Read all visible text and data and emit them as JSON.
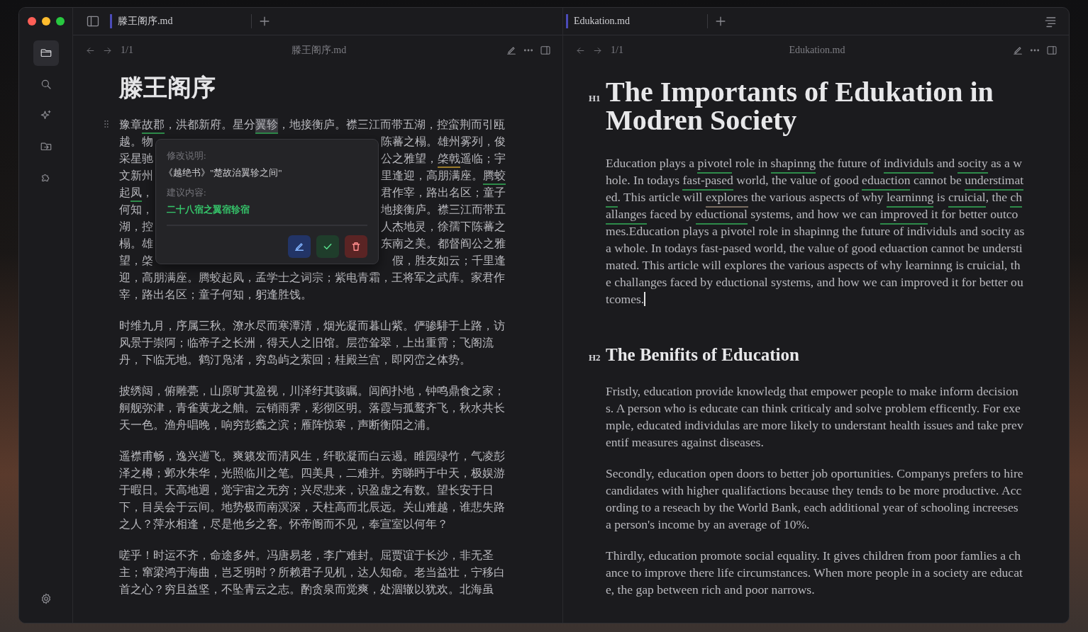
{
  "window": {
    "traffic_lights": [
      {
        "color": "#ff5f57"
      },
      {
        "color": "#febc2e"
      },
      {
        "color": "#28c840"
      }
    ]
  },
  "rail": {
    "items": [
      {
        "kind": "folder",
        "selected": true
      },
      {
        "kind": "search",
        "selected": false
      },
      {
        "kind": "sparkle",
        "selected": false
      },
      {
        "kind": "folder-arrow",
        "selected": false
      },
      {
        "kind": "puzzle",
        "selected": false
      }
    ],
    "bottom": [
      {
        "kind": "gear"
      }
    ]
  },
  "panes": [
    {
      "tab": {
        "title": "滕王阁序.md",
        "selected": true
      },
      "toolbar": {
        "page": "1/1",
        "title": "滕王阁序.md"
      },
      "blocks": [
        {
          "kind": "title",
          "text": "滕王阁序"
        },
        {
          "kind": "covered",
          "popup": {
            "note_label": "修改说明:",
            "note": "《越绝书》\"楚故治翼轸之间\"",
            "suggestion_label": "建议内容:",
            "suggestion": "二十八宿之翼宿轸宿",
            "actions": [
              {
                "kind": "edit"
              },
              {
                "kind": "accept"
              },
              {
                "kind": "delete"
              }
            ]
          },
          "lines": [
            {
              "full": [
                "豫章",
                {
                  "text": "故郡",
                  "color": "#2e8b4a",
                  "selected": false
                },
                "，洪都新府。星分",
                {
                  "text": "翼轸",
                  "color": "#2e8b4a",
                  "selected": true
                },
                "，地接衡庐。襟三江而带五湖，控蛮荆而引瓯"
              ]
            },
            {
              "left": [
                "越。物"
              ],
              "right": [
                "陈蕃之榻。雄州雾列，俊"
              ]
            },
            {
              "left": [
                "采星驰"
              ],
              "right": [
                "公之雅望，",
                {
                  "text": "棨戟",
                  "color": "#9a7a2a",
                  "selected": false
                },
                "遥临；宇"
              ]
            },
            {
              "left": [
                "文新州"
              ],
              "right": [
                "里逢迎，高朋满座。",
                {
                  "text": "腾蛟",
                  "color": "#2e8b4a",
                  "selected": false
                }
              ]
            },
            {
              "left": [
                "起",
                {
                  "text": "凤",
                  "color": "#2e8b4a",
                  "selected": false
                },
                "，"
              ],
              "right": [
                "君作宰，路出名区；童子"
              ]
            },
            {
              "left": [
                "何知，"
              ],
              "right": [
                "地接衡庐。襟三江而带五"
              ]
            },
            {
              "left": [
                "湖，控"
              ],
              "right": [
                "人杰地灵，徐孺下陈蕃之"
              ]
            },
            {
              "left": [
                "榻。雄"
              ],
              "right": [
                "东南之美。都督阎公之雅"
              ]
            },
            {
              "left": [
                "望，棨"
              ],
              "right": [
                "假，胜友如云；千里逢"
              ]
            },
            {
              "full": [
                "迎，高朋满座。腾蛟起凤，孟学士之词宗；紫电青霜，王将军之武库。家君作"
              ]
            },
            {
              "full": [
                "宰，路出名区；童子何知，躬逢胜饯。"
              ]
            }
          ]
        },
        {
          "kind": "paragraph",
          "runs": [
            "时维九月，序属三秋。潦水尽而寒潭清，烟光凝而暮山紫。俨骖騑于上路，访风景于崇阿；临帝子之长洲，得天人之旧馆。层峦耸翠，上出重霄；飞阁流丹，下临无地。鹤汀凫渚，穷岛屿之萦回；桂殿兰宫，即冈峦之体势。"
          ]
        },
        {
          "kind": "paragraph",
          "runs": [
            "披绣闼，俯雕甍，山原旷其盈视，川泽纡其骇瞩。闾阎扑地，钟鸣鼎食之家；舸舰弥津，青雀黄龙之舳。云销雨霁，彩彻区明。落霞与孤鹜齐飞，秋水共长天一色。渔舟唱晚，响穷彭蠡之滨；雁阵惊寒，声断衡阳之浦。"
          ]
        },
        {
          "kind": "paragraph",
          "runs": [
            "遥襟甫畅，逸兴遄飞。爽籁发而清风生，纤歌凝而白云遏。睢园绿竹，气凌彭泽之樽；邺水朱华，光照临川之笔。四美具，二难并。穷睇眄于中天，极娱游于暇日。天高地迥，觉宇宙之无穷；兴尽悲来，识盈虚之有数。望长安于日下，目吴会于云间。地势极而南溟深，天柱高而北辰远。关山难越，谁悲失路之人？萍水相逢，尽是他乡之客。怀帝阍而不见，奉宣室以何年？"
          ]
        },
        {
          "kind": "paragraph",
          "runs": [
            "嗟乎！时运不齐，命途多舛。冯唐易老，李广难封。屈贾谊于长沙，非无圣主；窜梁鸿于海曲，岂乏明时？所赖君子见机，达人知命。老当益壮，宁移白首之心？穷且益坚，不坠青云之志。酌贪泉而觉爽，处涸辙以犹欢。北海虽"
          ]
        }
      ]
    },
    {
      "tab": {
        "title": "Edukation.md",
        "selected": true
      },
      "toolbar": {
        "page": "1/1",
        "title": "Edukation.md"
      },
      "blocks": [
        {
          "kind": "h1",
          "label": "H1",
          "text": "The Importants of Edukation in Modren Society"
        },
        {
          "kind": "paragraph",
          "caret": true,
          "runs": [
            "Education plays a ",
            {
              "text": "pivotel",
              "color": "#2e8b4a",
              "selected": false
            },
            " role in ",
            {
              "text": "shapinng",
              "color": "#2e8b4a",
              "selected": false
            },
            " the future of ",
            {
              "text": "individuls",
              "color": "#2e8b4a",
              "selected": false
            },
            " and ",
            {
              "text": "socity",
              "color": "#2e8b4a",
              "selected": false
            },
            " as a whole. In todays ",
            {
              "text": "fast-pased",
              "color": "#2e8b4a",
              "selected": false
            },
            " world, the value of good ",
            {
              "text": "eduaction",
              "color": "#2e8b4a",
              "selected": false
            },
            " cannot be ",
            {
              "text": "understimated",
              "color": "#2e8b4a",
              "selected": false
            },
            ". This article will ",
            {
              "text": "explores",
              "color": "#7a6d60",
              "selected": false
            },
            " the various aspects of why ",
            {
              "text": "learninng",
              "color": "#2e8b4a",
              "selected": false
            },
            " is ",
            {
              "text": "cruicial",
              "color": "#2e8b4a",
              "selected": false
            },
            ", the ",
            {
              "text": "challanges",
              "color": "#2e8b4a",
              "selected": false
            },
            " faced by ",
            {
              "text": "eductional",
              "color": "#2e8b4a",
              "selected": false
            },
            " systems, and how we can ",
            {
              "text": "improved",
              "color": "#2e8b4a",
              "selected": false
            },
            " it for better outcomes.Education plays a pivotel role in shapinng the future of individuls and socity as a whole. In todays fast-pased world, the value of good eduaction cannot be understimated. This article will explores the various aspects of why learninng is cruicial, the challanges faced by eductional systems, and how we can improved it for better outcomes."
          ]
        },
        {
          "kind": "h2",
          "label": "H2",
          "text": "The Benifits of Education"
        },
        {
          "kind": "paragraph",
          "runs": [
            "Fristly, education provide knowledg that empower people to make inform decisions. A person who is educate can think criticaly and solve problem efficently. For exemple, educated individulas are more likely to understant health issues and take preventif measures against diseases."
          ]
        },
        {
          "kind": "paragraph",
          "runs": [
            "Secondly, education open doors to better job oportunities. Companys prefers to hire candidates with higher qualifactions because they tends to be more productive. According to a reseach by the World Bank, each additional year of schooling increeses a person's income by an average of 10%."
          ]
        },
        {
          "kind": "paragraph",
          "runs": [
            "Thirdly, education promote social equality. It gives children from poor famlies a chance to improve there life circumstances. When more people in a society are educate, the gap between rich and poor narrows."
          ]
        }
      ]
    }
  ]
}
